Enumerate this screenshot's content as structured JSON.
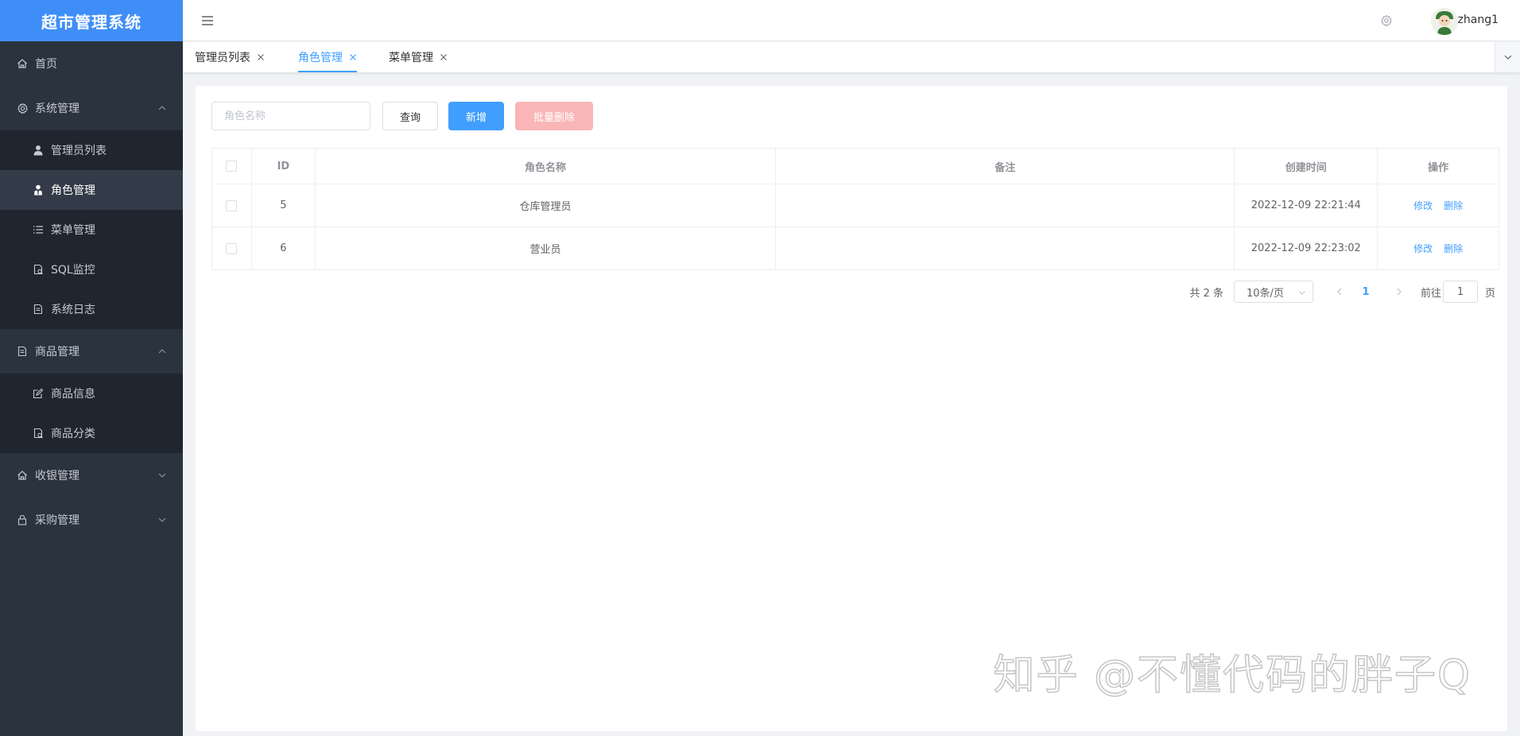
{
  "app": {
    "title": "超市管理系统"
  },
  "sidebar": {
    "items": [
      {
        "label": "首页",
        "icon": "home-icon"
      },
      {
        "label": "系统管理",
        "icon": "gear-icon",
        "expanded": true,
        "children": [
          {
            "label": "管理员列表",
            "icon": "user-icon"
          },
          {
            "label": "角色管理",
            "icon": "role-icon",
            "active": true
          },
          {
            "label": "菜单管理",
            "icon": "list-icon"
          },
          {
            "label": "SQL监控",
            "icon": "monitor-icon"
          },
          {
            "label": "系统日志",
            "icon": "document-icon"
          }
        ]
      },
      {
        "label": "商品管理",
        "icon": "document-icon",
        "expanded": true,
        "children": [
          {
            "label": "商品信息",
            "icon": "edit-icon"
          },
          {
            "label": "商品分类",
            "icon": "category-icon"
          }
        ]
      },
      {
        "label": "收银管理",
        "icon": "home-icon",
        "expanded": false
      },
      {
        "label": "采购管理",
        "icon": "lock-icon",
        "expanded": false
      }
    ]
  },
  "header": {
    "username": "zhang1"
  },
  "tabs": [
    {
      "label": "管理员列表",
      "active": false
    },
    {
      "label": "角色管理",
      "active": true
    },
    {
      "label": "菜单管理",
      "active": false
    }
  ],
  "toolbar": {
    "search_placeholder": "角色名称",
    "search_value": "",
    "query_label": "查询",
    "add_label": "新增",
    "batch_delete_label": "批量删除"
  },
  "table": {
    "headers": [
      "",
      "ID",
      "角色名称",
      "备注",
      "创建时间",
      "操作"
    ],
    "rows": [
      {
        "id": "5",
        "name": "仓库管理员",
        "remark": "",
        "created": "2022-12-09 22:21:44"
      },
      {
        "id": "6",
        "name": "营业员",
        "remark": "",
        "created": "2022-12-09 22:23:02"
      }
    ],
    "edit_label": "修改",
    "delete_label": "删除"
  },
  "pagination": {
    "total_text": "共 2 条",
    "page_size": "10条/页",
    "current_page": "1",
    "goto_label": "前往",
    "goto_value": "1",
    "page_suffix": "页"
  },
  "watermark": "知乎 @不懂代码的胖子Q",
  "colors": {
    "primary": "#409eff",
    "sidebar_bg": "#2b333e",
    "logo_bg": "#3f8ef7",
    "danger_disabled": "#fab6b6"
  }
}
